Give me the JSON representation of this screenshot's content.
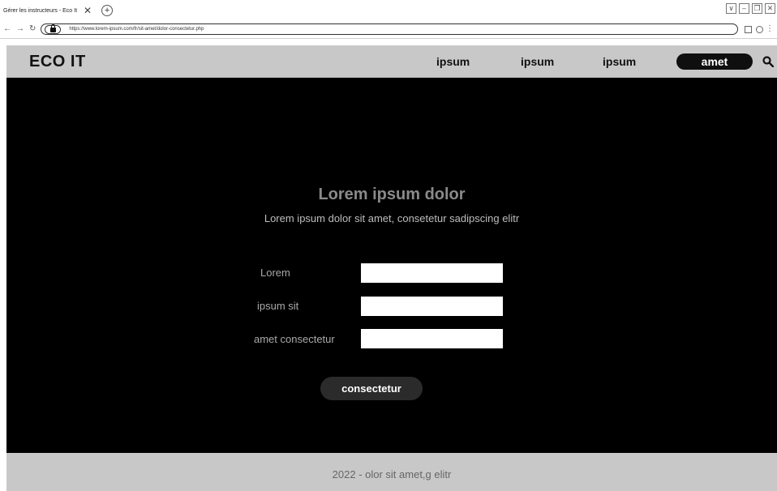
{
  "browser": {
    "tab_title": "Gérer les instructeurs - Eco It",
    "tab_close": "✕",
    "new_tab": "+",
    "url": "https://www.lorem-ipsum.com/fr/sit-amet/dolor-consectetur.php",
    "back_glyph": "←",
    "forward_glyph": "→",
    "reload_glyph": "↻",
    "menu_glyph": "⋮",
    "min_glyph": "–",
    "max_glyph": "❐",
    "close_glyph": "✕",
    "dropdown_glyph": "∨"
  },
  "header": {
    "logo": "ECO IT",
    "nav": [
      "ipsum",
      "ipsum",
      "ipsum"
    ],
    "cta": "amet"
  },
  "hero": {
    "title": "Lorem ipsum dolor",
    "subtitle": "Lorem ipsum dolor sit amet, consetetur sadipscing elitr"
  },
  "form": {
    "fields": [
      {
        "label": "Lorem",
        "value": ""
      },
      {
        "label": "ipsum sit",
        "value": ""
      },
      {
        "label": "amet consectetur",
        "value": ""
      }
    ],
    "submit": "consectetur"
  },
  "footer": {
    "text": "2022 - olor sit amet,g elitr"
  }
}
